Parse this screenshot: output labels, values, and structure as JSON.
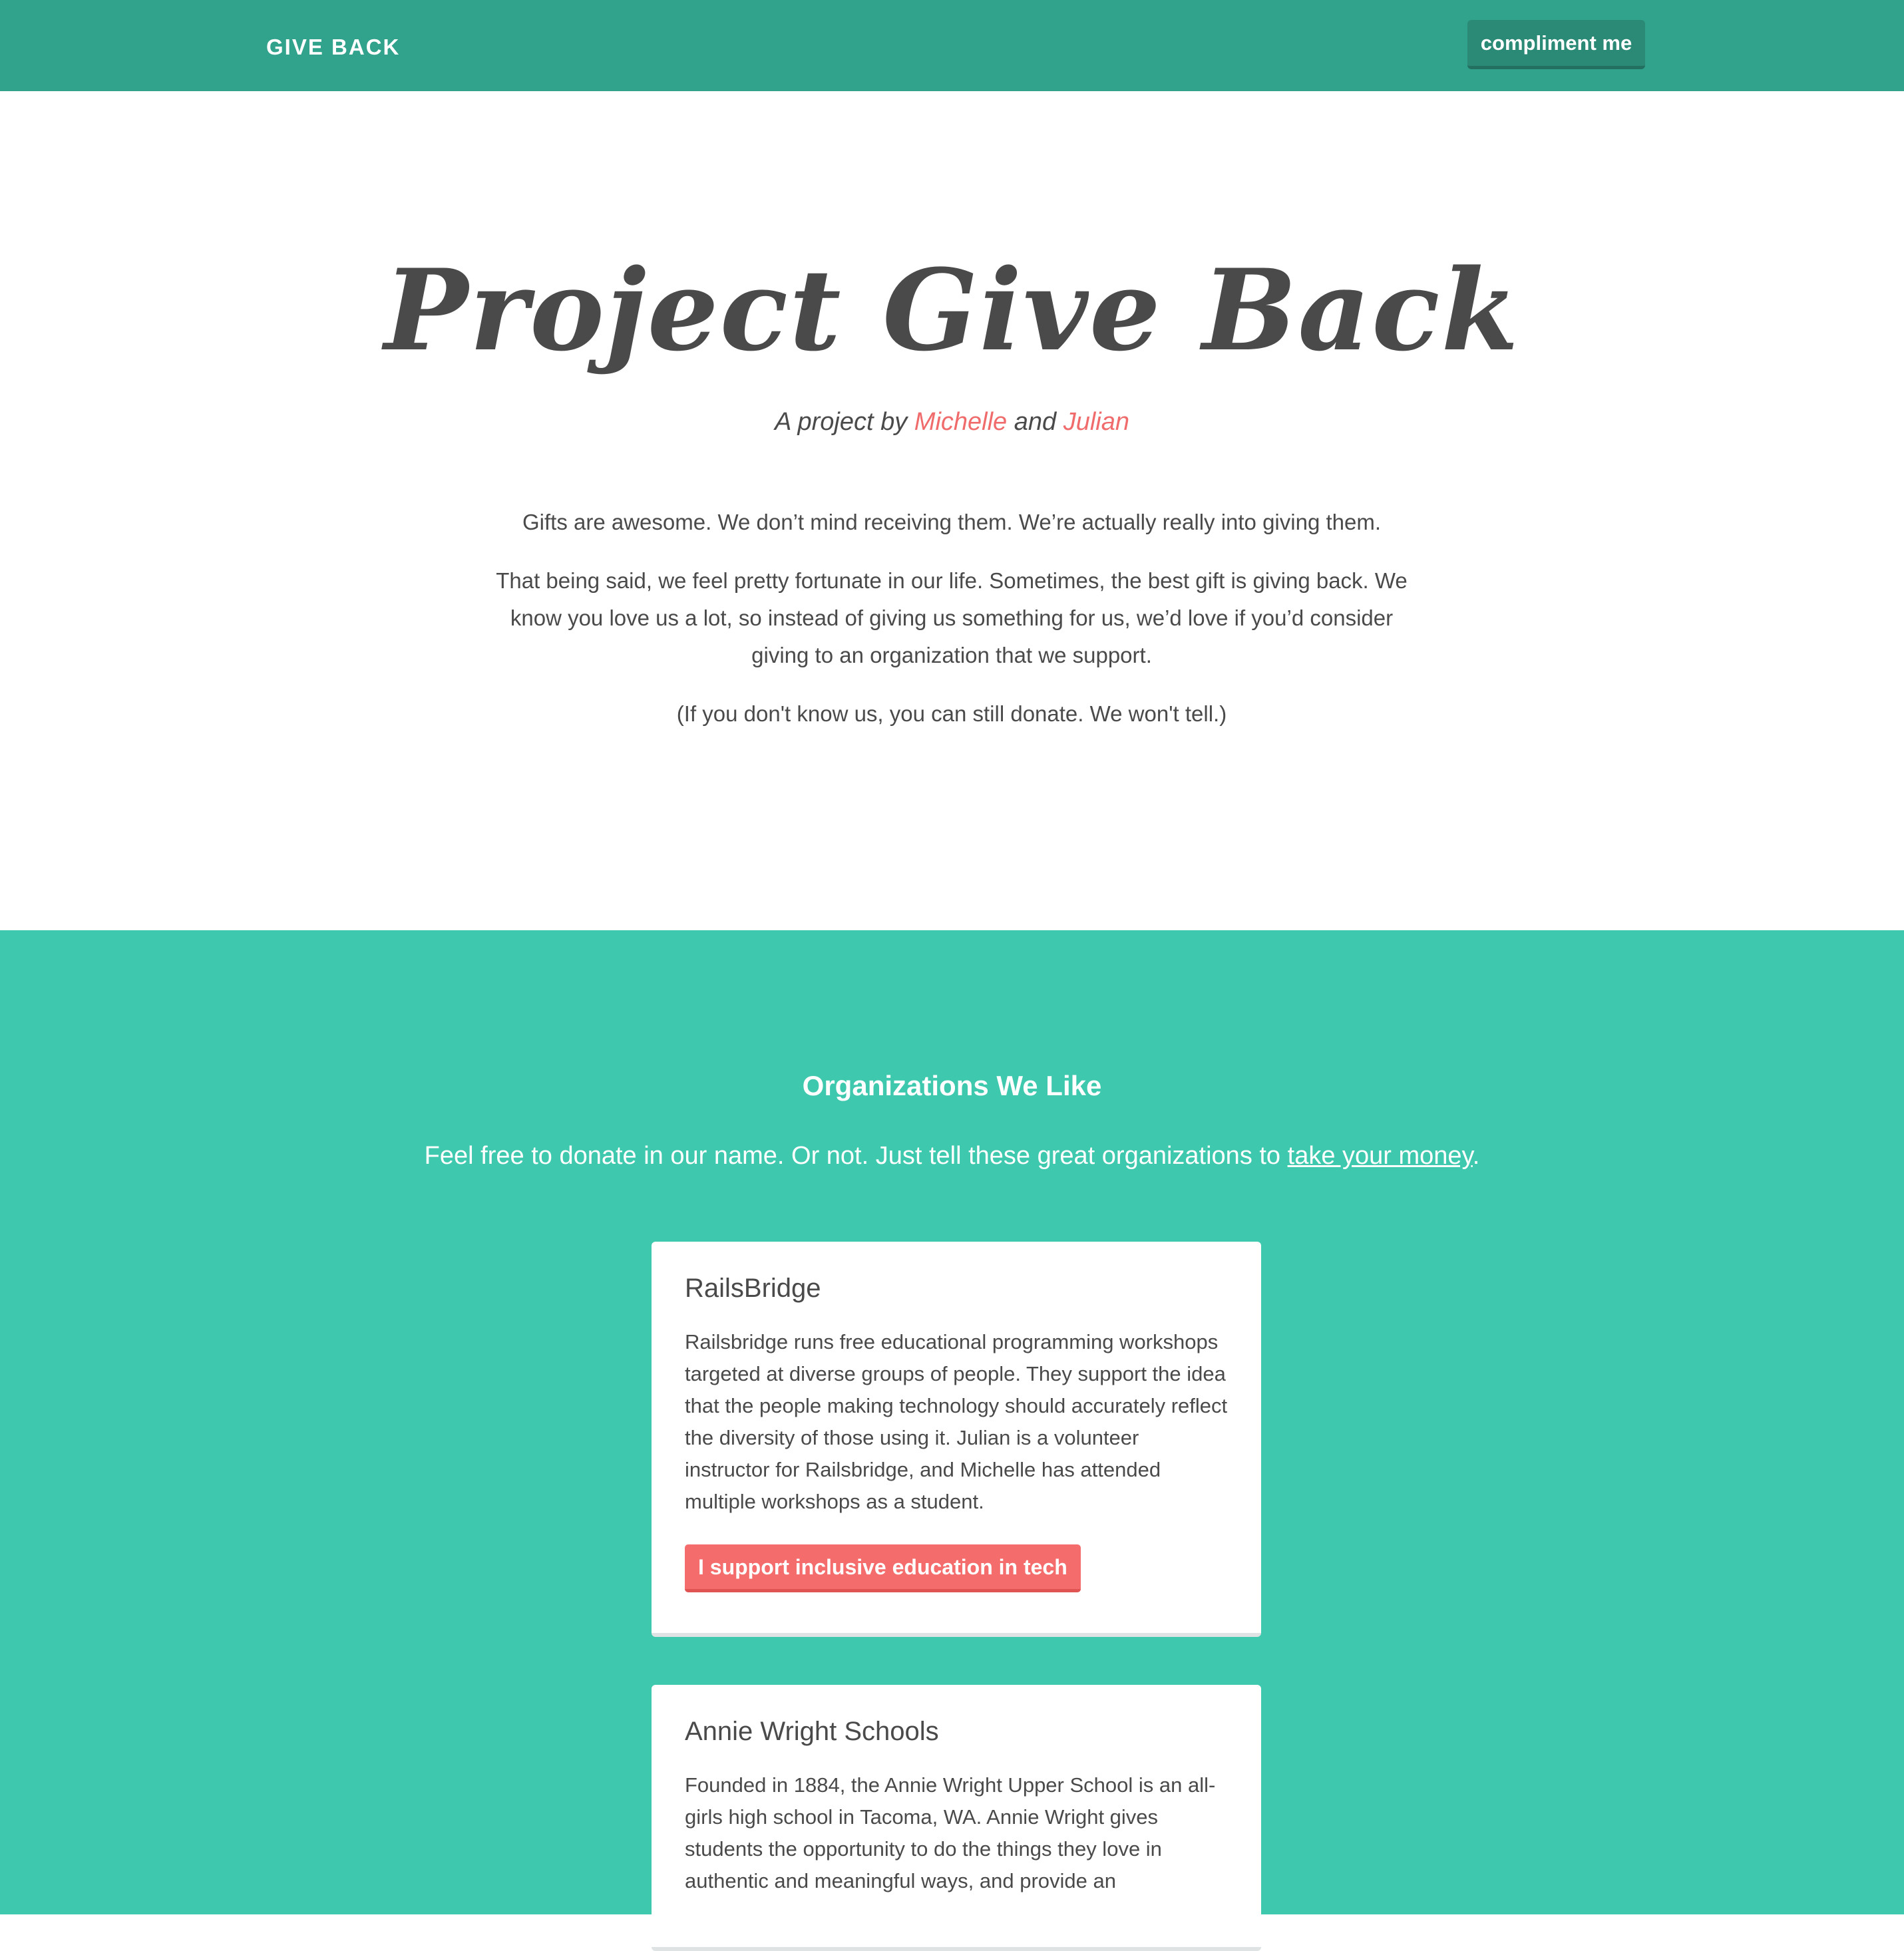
{
  "nav": {
    "brand": "GIVE BACK",
    "button_label": "compliment me"
  },
  "hero": {
    "title": "Project Give Back",
    "byline_prefix": "A project by",
    "byline_name_1": "Michelle",
    "byline_and": "and",
    "byline_name_2": "Julian",
    "paragraphs": [
      "Gifts are awesome. We don’t mind receiving them. We’re actually really into giving them.",
      "That being said, we feel pretty fortunate in our life. Sometimes, the best gift is giving back. We know you love us a lot, so instead of giving us something for us, we’d love if you’d consider giving to an organization that we support.",
      "(If you don't know us, you can still donate. We won't tell.)"
    ]
  },
  "orgs": {
    "title": "Organizations We Like",
    "subtitle_text": "Feel free to donate in our name. Or not. Just tell these great organizations to",
    "subtitle_link": "take your money",
    "subtitle_end": ".",
    "cards": [
      {
        "name": "RailsBridge",
        "description": "Railsbridge runs free educational programming workshops targeted at diverse groups of people. They support the idea that the people making technology should accurately reflect the diversity of those using it. Julian is a volunteer instructor for Railsbridge, and Michelle has attended multiple workshops as a student.",
        "button_label": "I support inclusive education in tech"
      },
      {
        "name": "Annie Wright Schools",
        "description": "Founded in 1884, the Annie Wright Upper School is an all-girls high school in Tacoma, WA. Annie Wright gives students the opportunity to do the things they love in authentic and meaningful ways, and provide an"
      }
    ]
  },
  "colors": {
    "navbar": "#31a38c",
    "section": "#3ec9ae",
    "accent": "#f06b6b"
  }
}
